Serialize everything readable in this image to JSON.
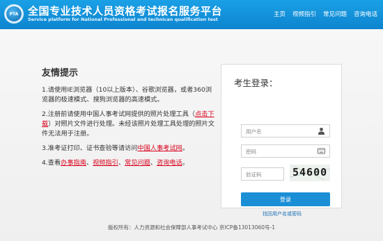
{
  "header": {
    "logo_text": "PTA",
    "title": "全国专业技术人员资格考试报名服务平台",
    "subtitle": "Service platform for National Professional and technican qualification test",
    "nav": [
      "主页",
      "视频指引",
      "常见问题",
      "咨询电话"
    ]
  },
  "tips": {
    "title": "友情提示",
    "item1": "1.请使用IE浏览器（10以上版本）、谷歌浏览器，或者360浏览器的极速模式、搜狗浏览器的高速模式。",
    "item2_prefix": "2.注册前请使用中国人事考试网提供的照片处理工具（",
    "item2_link": "点击下载",
    "item2_suffix": "）对照片文件进行处理。未经该照片处理工具处理的照片文件无法用于注册。",
    "item3_prefix": "3.准考证打印、证书查验等请访问",
    "item3_link": "中国人事考试网",
    "item3_suffix": "。",
    "item4_prefix": "4.查看",
    "item4_link1": "办事指南",
    "item4_sep1": "、",
    "item4_link2": "视频指引",
    "item4_sep2": "、",
    "item4_link3": "常见问题",
    "item4_sep3": "、",
    "item4_link4": "咨询电话",
    "item4_suffix": "。"
  },
  "login": {
    "title": "考生登录：",
    "username_placeholder": "用户名",
    "password_placeholder": "密码",
    "captcha_placeholder": "验证码",
    "captcha_text": "54600",
    "submit_label": "登录",
    "forgot_label": "找回用户名或密码"
  },
  "footer": {
    "text": "版权所有：人力资源和社会保障部人事考试中心 京ICP备13013060号-1"
  },
  "colors": {
    "header_blue": "#1aa0e6",
    "link_red": "#d9001b",
    "button_blue": "#1b8fd6"
  }
}
